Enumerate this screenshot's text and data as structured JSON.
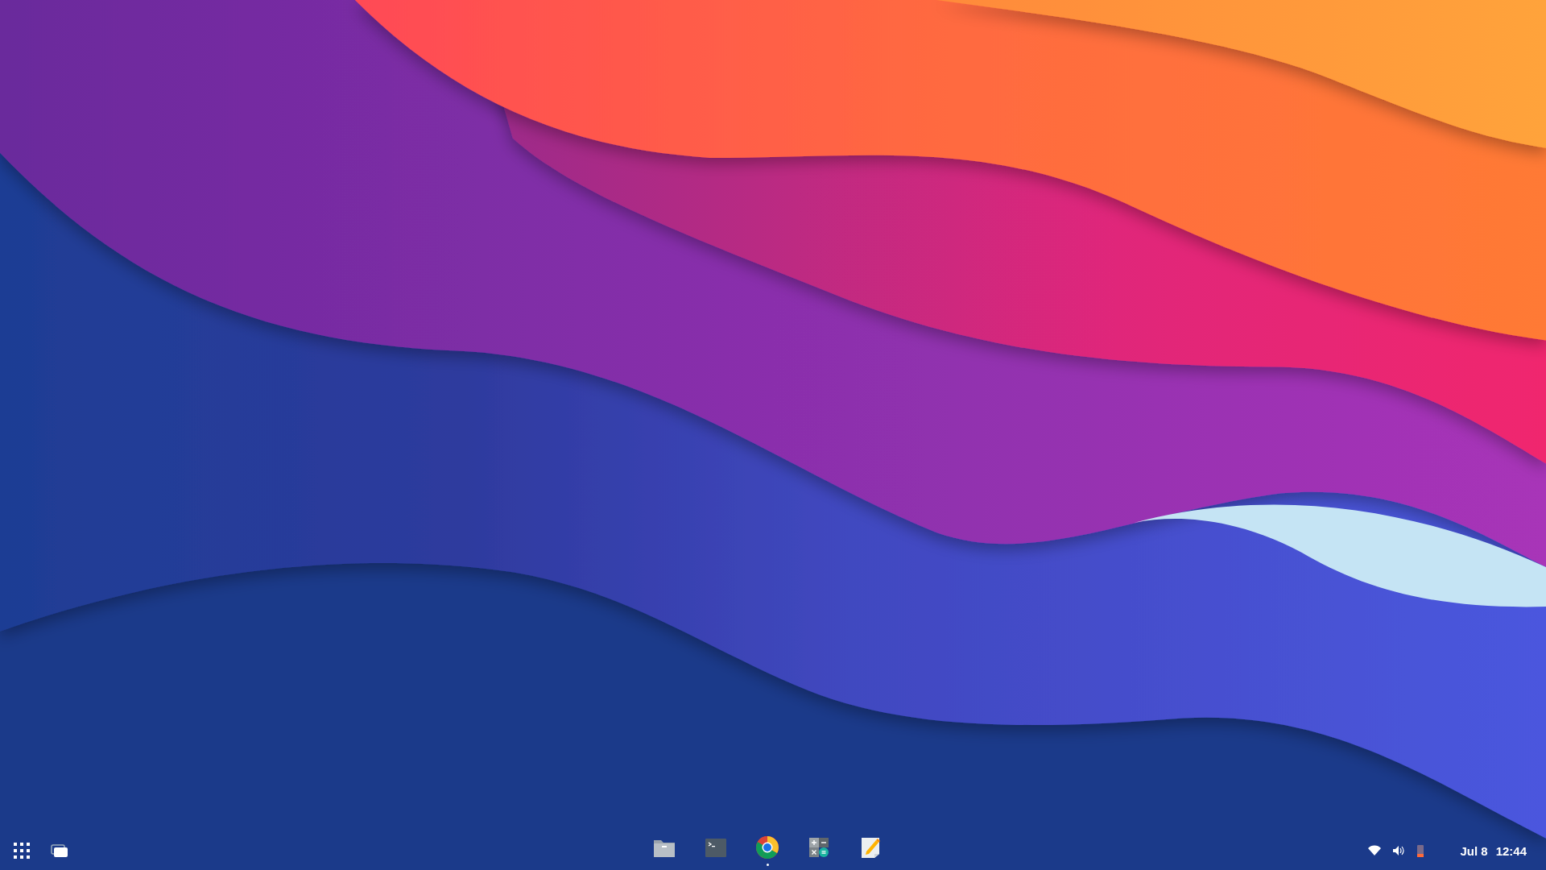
{
  "shelf": {
    "apps": [
      {
        "kind": "files",
        "running": false
      },
      {
        "kind": "terminal",
        "running": false
      },
      {
        "kind": "browser",
        "running": true
      },
      {
        "kind": "calculator",
        "running": false
      },
      {
        "kind": "notes",
        "running": false
      }
    ]
  },
  "status_area": {
    "date": "Jul 8",
    "time": "12:44"
  }
}
